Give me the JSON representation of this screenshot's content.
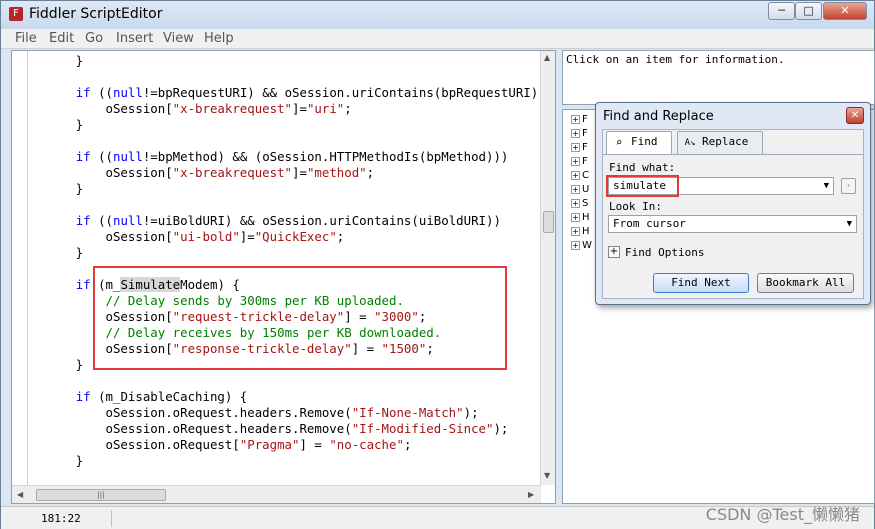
{
  "window": {
    "title": "Fiddler ScriptEditor",
    "minimize": "─",
    "maximize": "□",
    "close": "✕"
  },
  "menu": [
    "File",
    "Edit",
    "Go",
    "Insert",
    "View",
    "Help"
  ],
  "code": {
    "lines": [
      {
        "segments": [
          {
            "t": "        }"
          }
        ]
      },
      {
        "segments": [
          {
            "t": ""
          }
        ]
      },
      {
        "segments": [
          {
            "t": "        "
          },
          {
            "t": "if",
            "c": "kw"
          },
          {
            "t": " (("
          },
          {
            "t": "null",
            "c": "kw"
          },
          {
            "t": "!=bpRequestURI) && oSession.uriContains(bpRequestURI))"
          }
        ]
      },
      {
        "segments": [
          {
            "t": "            oSession["
          },
          {
            "t": "\"x-breakrequest\"",
            "c": "str"
          },
          {
            "t": "]="
          },
          {
            "t": "\"uri\"",
            "c": "str"
          },
          {
            "t": ";"
          }
        ]
      },
      {
        "segments": [
          {
            "t": "        }"
          }
        ]
      },
      {
        "segments": [
          {
            "t": ""
          }
        ]
      },
      {
        "segments": [
          {
            "t": "        "
          },
          {
            "t": "if",
            "c": "kw"
          },
          {
            "t": " (("
          },
          {
            "t": "null",
            "c": "kw"
          },
          {
            "t": "!=bpMethod) && (oSession.HTTPMethodIs(bpMethod)))"
          }
        ]
      },
      {
        "segments": [
          {
            "t": "            oSession["
          },
          {
            "t": "\"x-breakrequest\"",
            "c": "str"
          },
          {
            "t": "]="
          },
          {
            "t": "\"method\"",
            "c": "str"
          },
          {
            "t": ";"
          }
        ]
      },
      {
        "segments": [
          {
            "t": "        }"
          }
        ]
      },
      {
        "segments": [
          {
            "t": ""
          }
        ]
      },
      {
        "segments": [
          {
            "t": "        "
          },
          {
            "t": "if",
            "c": "kw"
          },
          {
            "t": " (("
          },
          {
            "t": "null",
            "c": "kw"
          },
          {
            "t": "!=uiBoldURI) && oSession.uriContains(uiBoldURI))"
          }
        ]
      },
      {
        "segments": [
          {
            "t": "            oSession["
          },
          {
            "t": "\"ui-bold\"",
            "c": "str"
          },
          {
            "t": "]="
          },
          {
            "t": "\"QuickExec\"",
            "c": "str"
          },
          {
            "t": ";"
          }
        ]
      },
      {
        "segments": [
          {
            "t": "        }"
          }
        ]
      },
      {
        "segments": [
          {
            "t": ""
          }
        ]
      },
      {
        "segments": [
          {
            "t": "        "
          },
          {
            "t": "if",
            "c": "kw"
          },
          {
            "t": " (m_"
          },
          {
            "t": "Simulate",
            "c": "hl"
          },
          {
            "t": "Modem) {"
          }
        ]
      },
      {
        "segments": [
          {
            "t": "            "
          },
          {
            "t": "// Delay sends by 300ms per KB uploaded.",
            "c": "cmt"
          }
        ]
      },
      {
        "segments": [
          {
            "t": "            oSession["
          },
          {
            "t": "\"request-trickle-delay\"",
            "c": "str"
          },
          {
            "t": "] = "
          },
          {
            "t": "\"3000\"",
            "c": "str"
          },
          {
            "t": ";"
          }
        ]
      },
      {
        "segments": [
          {
            "t": "            "
          },
          {
            "t": "// Delay receives by 150ms per KB downloaded.",
            "c": "cmt"
          }
        ]
      },
      {
        "segments": [
          {
            "t": "            oSession["
          },
          {
            "t": "\"response-trickle-delay\"",
            "c": "str"
          },
          {
            "t": "] = "
          },
          {
            "t": "\"1500\"",
            "c": "str"
          },
          {
            "t": ";"
          }
        ]
      },
      {
        "segments": [
          {
            "t": "        }"
          }
        ]
      },
      {
        "segments": [
          {
            "t": ""
          }
        ]
      },
      {
        "segments": [
          {
            "t": "        "
          },
          {
            "t": "if",
            "c": "kw"
          },
          {
            "t": " (m_DisableCaching) {"
          }
        ]
      },
      {
        "segments": [
          {
            "t": "            oSession.oRequest.headers.Remove("
          },
          {
            "t": "\"If-None-Match\"",
            "c": "str"
          },
          {
            "t": ");"
          }
        ]
      },
      {
        "segments": [
          {
            "t": "            oSession.oRequest.headers.Remove("
          },
          {
            "t": "\"If-Modified-Since\"",
            "c": "str"
          },
          {
            "t": ");"
          }
        ]
      },
      {
        "segments": [
          {
            "t": "            oSession.oRequest["
          },
          {
            "t": "\"Pragma\"",
            "c": "str"
          },
          {
            "t": "] = "
          },
          {
            "t": "\"no-cache\"",
            "c": "str"
          },
          {
            "t": ";"
          }
        ]
      },
      {
        "segments": [
          {
            "t": "        }"
          }
        ]
      }
    ]
  },
  "info_panel": {
    "text": "Click on an item for information."
  },
  "tree": {
    "items": [
      "F",
      "F",
      "F",
      "F",
      "C",
      "U",
      "S",
      "H",
      "H",
      "W"
    ]
  },
  "status": {
    "position": "181:22"
  },
  "watermark": "CSDN @Test_懒懒猪",
  "dialog": {
    "title": "Find and Replace",
    "close": "✕",
    "tabs": {
      "find": "Find",
      "replace": "Replace"
    },
    "find_what_label": "Find what:",
    "find_value": "simulate",
    "look_in_label": "Look In:",
    "look_in_value": "From cursor",
    "find_options_label": "Find Options",
    "find_next": "Find Next",
    "bookmark_all": "Bookmark All"
  },
  "colors": {
    "highlight_box": "#e03a3a",
    "keyword": "#0000ff",
    "string": "#a31515",
    "comment": "#008000"
  }
}
